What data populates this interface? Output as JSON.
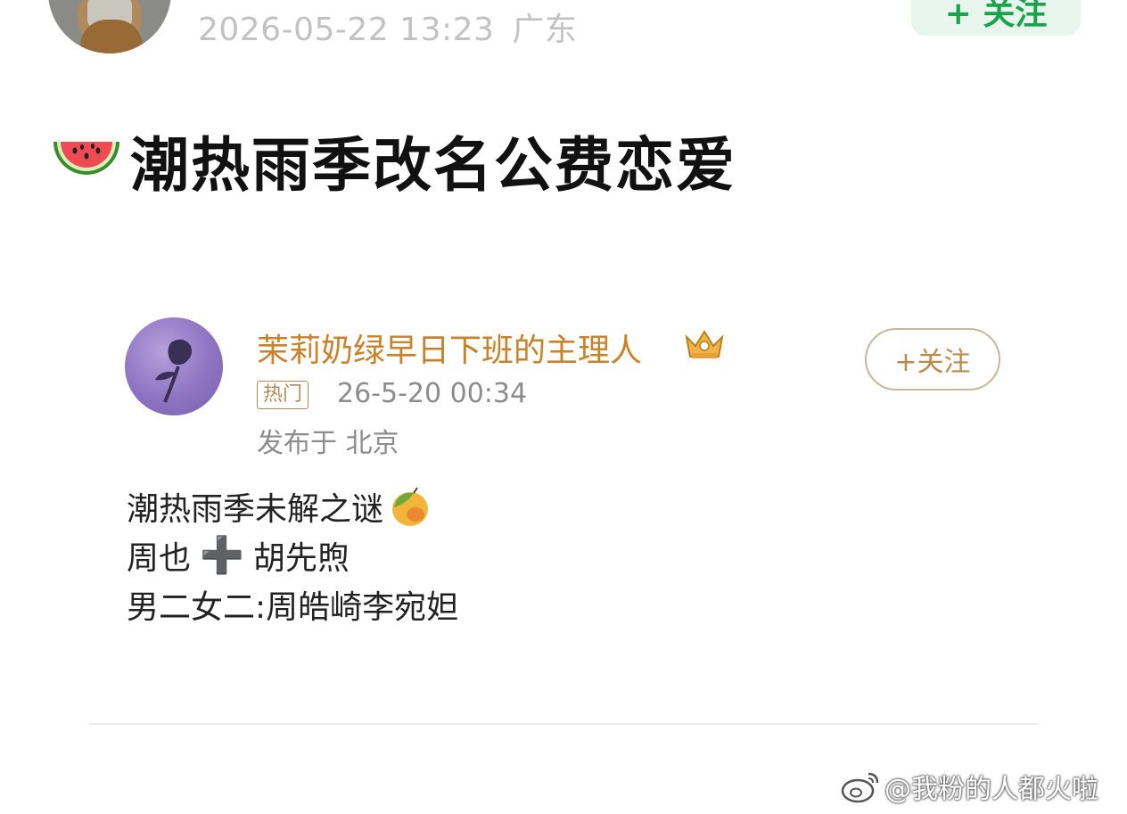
{
  "header": {
    "datetime": "2026-05-22 13:23",
    "location": "广东",
    "follow_label": "+ 关注"
  },
  "post": {
    "title": "潮热雨季改名公费恋爱",
    "title_icon": "watermelon-emoji"
  },
  "embedded_post": {
    "username": "茉莉奶绿早日下班的主理人",
    "badge_icon": "crown-icon",
    "follow_label": "+关注",
    "hot_tag": "热门",
    "timestamp": "26-5-20 00:34",
    "location": "发布于 北京",
    "lines": {
      "line1": "潮热雨季未解之谜",
      "line2_a": "周也",
      "line2_plus": "➕",
      "line2_b": "胡先煦",
      "line3": "男二女二:周皓崎李宛妲"
    }
  },
  "watermark": {
    "text": "@我粉的人都火啦"
  },
  "colors": {
    "follow_green": "#1aa34a",
    "username_gold": "#c9822a",
    "meta_gray": "#8c8c8c"
  }
}
